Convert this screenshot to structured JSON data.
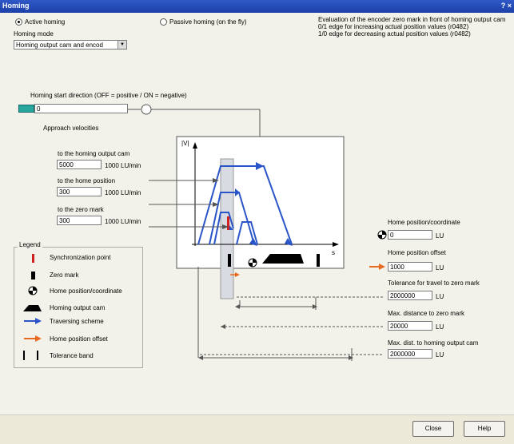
{
  "window": {
    "title": "Homing",
    "buttons": "? ×"
  },
  "mode": {
    "active_label": "Active homing",
    "passive_label": "Passive homing (on the fly)",
    "homing_mode_label": "Homing mode",
    "homing_mode_value": "Homing output cam and encod",
    "evaluation_text_1": "Evaluation of the encoder zero mark in front of homing output cam",
    "evaluation_text_2": "0/1 edge for increasing actual position values (r0482)",
    "evaluation_text_3": "1/0 edge for decreasing actual position values (r0482)"
  },
  "start_direction": {
    "label": "Homing start direction (OFF = positive / ON = negative)",
    "value": "0"
  },
  "velocities": {
    "section_label": "Approach velocities",
    "cam_label": "to the homing output cam",
    "cam_value": "5000",
    "cam_unit": "1000 LU/min",
    "home_label": "to the home position",
    "home_value": "300",
    "home_unit": "1000 LU/min",
    "zero_label": "to the zero mark",
    "zero_value": "300",
    "zero_unit": "1000 LU/min"
  },
  "graph": {
    "y_label": "|V|",
    "x_label": "s"
  },
  "right_params": {
    "home_coord_label": "Home position/coordinate",
    "home_coord_value": "0",
    "home_coord_unit": "LU",
    "offset_label": "Home position offset",
    "offset_value": "1000",
    "offset_unit": "LU",
    "tolerance_label": "Tolerance for travel to zero mark",
    "tolerance_value": "2000000",
    "tolerance_unit": "LU",
    "maxzero_label": "Max. distance to zero mark",
    "maxzero_value": "20000",
    "maxzero_unit": "LU",
    "maxcam_label": "Max. dist. to homing output cam",
    "maxcam_value": "2000000",
    "maxcam_unit": "LU"
  },
  "legend": {
    "title": "Legend",
    "sync": "Synchronization point",
    "zero": "Zero mark",
    "home": "Home position/coordinate",
    "cam": "Homing output cam",
    "traverse": "Traversing scheme",
    "offset": "Home position offset",
    "tolerance": "Tolerance band"
  },
  "colors": {
    "blue": "#2a55c8",
    "orange": "#e86a20",
    "red": "#d02020",
    "teal": "#2aa8a0"
  },
  "footer": {
    "close": "Close",
    "help": "Help"
  }
}
